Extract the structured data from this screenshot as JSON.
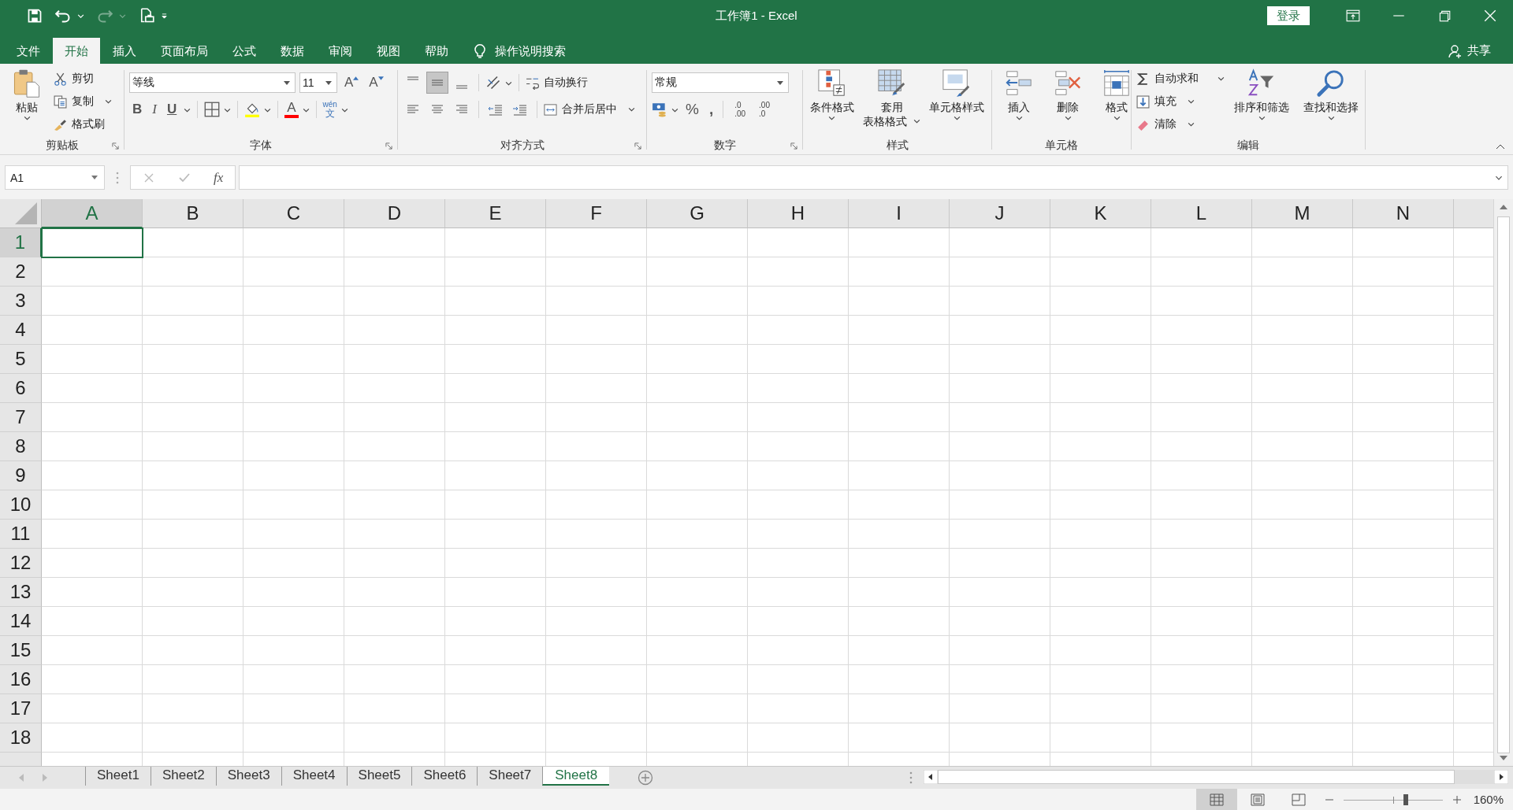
{
  "window": {
    "title": "工作簿1 - Excel",
    "sign_in": "登录"
  },
  "quick_access": {
    "redo": {
      "disabled": true
    }
  },
  "tabs": [
    {
      "label": "文件",
      "selected": false
    },
    {
      "label": "开始",
      "selected": true
    },
    {
      "label": "插入",
      "selected": false
    },
    {
      "label": "页面布局",
      "selected": false
    },
    {
      "label": "公式",
      "selected": false
    },
    {
      "label": "数据",
      "selected": false
    },
    {
      "label": "审阅",
      "selected": false
    },
    {
      "label": "视图",
      "selected": false
    },
    {
      "label": "帮助",
      "selected": false
    }
  ],
  "tell_me": "操作说明搜索",
  "share": "共享",
  "ribbon": {
    "clipboard": {
      "paste": "粘贴",
      "cut": "剪切",
      "copy": "复制",
      "format_painter": "格式刷",
      "label": "剪贴板"
    },
    "font": {
      "name": "等线",
      "size": "11",
      "grow": "A",
      "shrink": "A",
      "bold": "B",
      "italic": "I",
      "underline": "U",
      "font_color": "A",
      "phonetic_top": "wén",
      "phonetic_bottom": "文",
      "label": "字体"
    },
    "alignment": {
      "vertical": [
        {
          "selected": false
        },
        {
          "selected": true
        },
        {
          "selected": false
        }
      ],
      "wrap": "自动换行",
      "merge": "合并后居中",
      "label": "对齐方式"
    },
    "number": {
      "format": "常规",
      "percent": "%",
      "comma": ",",
      "increase_decimal": {
        "top": ".0",
        "bottom": ".00"
      },
      "decrease_decimal": {
        "top": ".00",
        "bottom": ".0"
      },
      "label": "数字"
    },
    "styles": {
      "conditional": "条件格式",
      "table_top": "套用",
      "table_bottom": "表格格式",
      "cell_styles": "单元格样式",
      "label": "样式"
    },
    "cells": {
      "insert": "插入",
      "delete": "删除",
      "format": "格式",
      "label": "单元格"
    },
    "editing": {
      "autosum": "自动求和",
      "fill": "填充",
      "clear": "清除",
      "sort": "排序和筛选",
      "find": "查找和选择",
      "label": "编辑"
    }
  },
  "formula_bar": {
    "name_box": "A1",
    "fx": "fx"
  },
  "sheet": {
    "columns": [
      {
        "label": "A",
        "selected": true
      },
      {
        "label": "B",
        "selected": false
      },
      {
        "label": "C",
        "selected": false
      },
      {
        "label": "D",
        "selected": false
      },
      {
        "label": "E",
        "selected": false
      },
      {
        "label": "F",
        "selected": false
      },
      {
        "label": "G",
        "selected": false
      },
      {
        "label": "H",
        "selected": false
      },
      {
        "label": "I",
        "selected": false
      },
      {
        "label": "J",
        "selected": false
      },
      {
        "label": "K",
        "selected": false
      },
      {
        "label": "L",
        "selected": false
      },
      {
        "label": "M",
        "selected": false
      },
      {
        "label": "N",
        "selected": false
      }
    ],
    "rows": [
      {
        "label": "1",
        "selected": true
      },
      {
        "label": "2",
        "selected": false
      },
      {
        "label": "3",
        "selected": false
      },
      {
        "label": "4",
        "selected": false
      },
      {
        "label": "5",
        "selected": false
      },
      {
        "label": "6",
        "selected": false
      },
      {
        "label": "7",
        "selected": false
      },
      {
        "label": "8",
        "selected": false
      },
      {
        "label": "9",
        "selected": false
      },
      {
        "label": "10",
        "selected": false
      },
      {
        "label": "11",
        "selected": false
      },
      {
        "label": "12",
        "selected": false
      },
      {
        "label": "13",
        "selected": false
      },
      {
        "label": "14",
        "selected": false
      },
      {
        "label": "15",
        "selected": false
      },
      {
        "label": "16",
        "selected": false
      },
      {
        "label": "17",
        "selected": false
      },
      {
        "label": "18",
        "selected": false
      }
    ]
  },
  "sheet_tabs": [
    {
      "label": "Sheet1",
      "selected": false
    },
    {
      "label": "Sheet2",
      "selected": false
    },
    {
      "label": "Sheet3",
      "selected": false
    },
    {
      "label": "Sheet4",
      "selected": false
    },
    {
      "label": "Sheet5",
      "selected": false
    },
    {
      "label": "Sheet6",
      "selected": false
    },
    {
      "label": "Sheet7",
      "selected": false
    },
    {
      "label": "Sheet8",
      "selected": true
    }
  ],
  "status_bar": {
    "views": [
      {
        "kind": "normal",
        "selected": true
      },
      {
        "kind": "page_layout",
        "selected": false
      },
      {
        "kind": "page_break",
        "selected": false
      }
    ],
    "zoom": {
      "level": 0.6,
      "reading": "160%"
    }
  }
}
